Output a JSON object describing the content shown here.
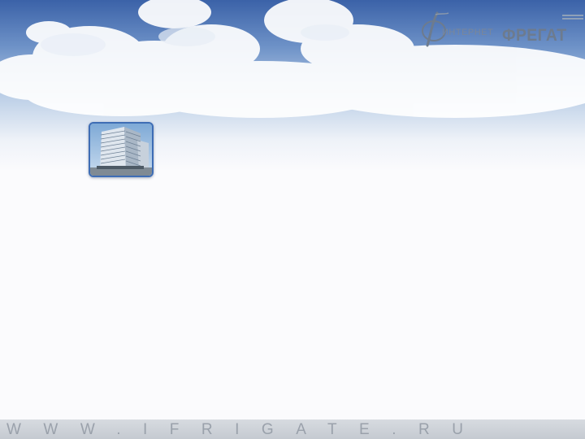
{
  "logo": {
    "small_text": "ИНТЕРНЕТ",
    "big_text": "ФРЕГАТ",
    "color": "#6d7b8e"
  },
  "tile": {
    "icon": "building-thumbnail-icon"
  },
  "footer": {
    "url_text": "WWW.IFRIGATE.RU"
  },
  "colors": {
    "sky_top": "#3b62a8",
    "tile_border": "#3e6db5",
    "background": "#fbfbfd"
  }
}
